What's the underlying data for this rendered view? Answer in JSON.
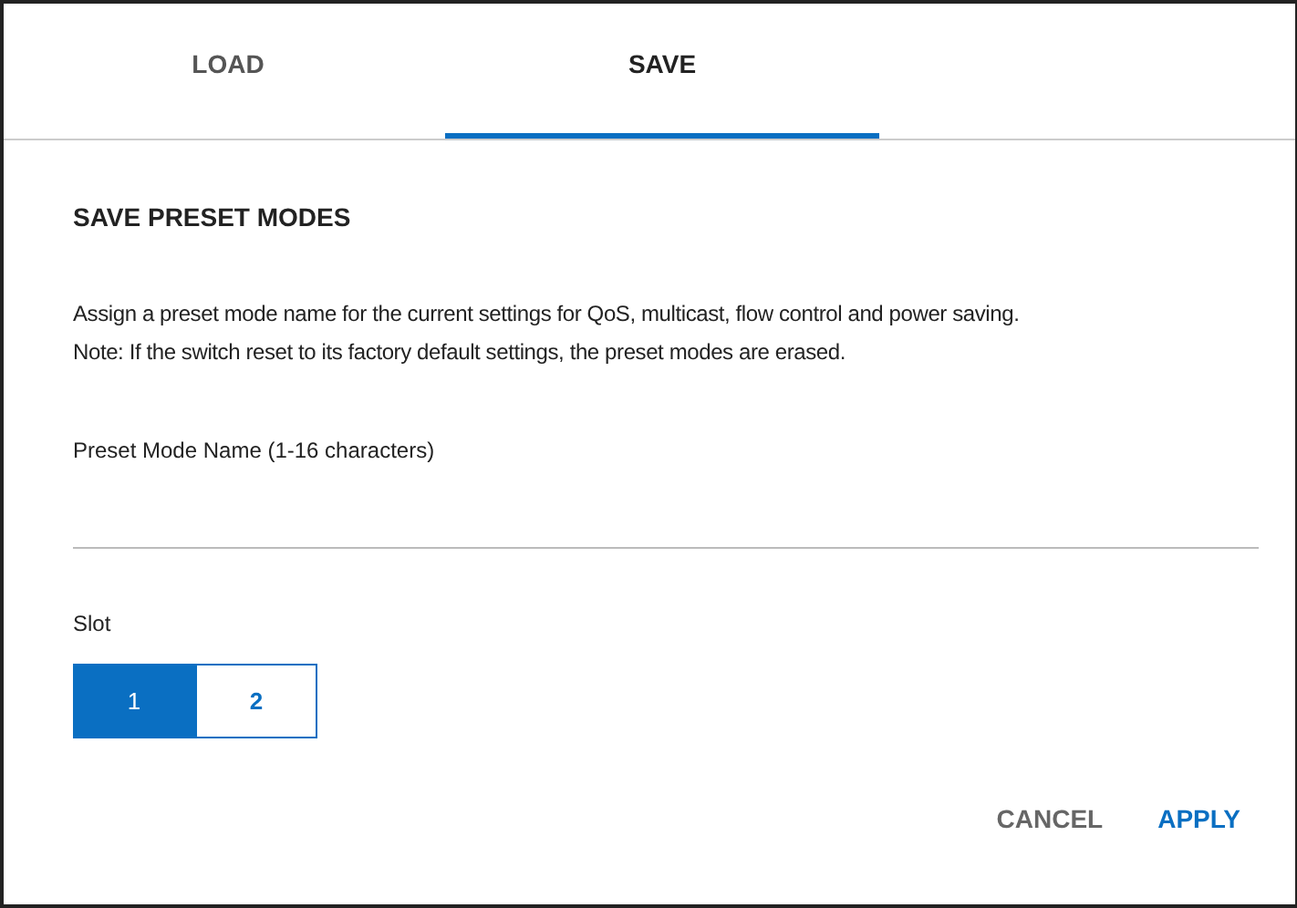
{
  "tabs": [
    {
      "label": "LOAD",
      "selected": false
    },
    {
      "label": "SAVE",
      "selected": true
    }
  ],
  "section": {
    "title": "SAVE PRESET MODES",
    "description": [
      "Assign a preset mode name for the current settings for QoS, multicast, flow control and power saving.",
      "Note: If the switch reset to its factory default settings, the preset modes are erased."
    ]
  },
  "name_field": {
    "label": "Preset Mode Name (1-16 characters)"
  },
  "slot": {
    "label": "Slot",
    "options": [
      {
        "label": "1",
        "selected": true
      },
      {
        "label": "2",
        "selected": false
      }
    ]
  },
  "buttons": [
    {
      "label": "CANCEL",
      "kind": "secondary"
    },
    {
      "label": "APPLY",
      "kind": "primary"
    }
  ]
}
